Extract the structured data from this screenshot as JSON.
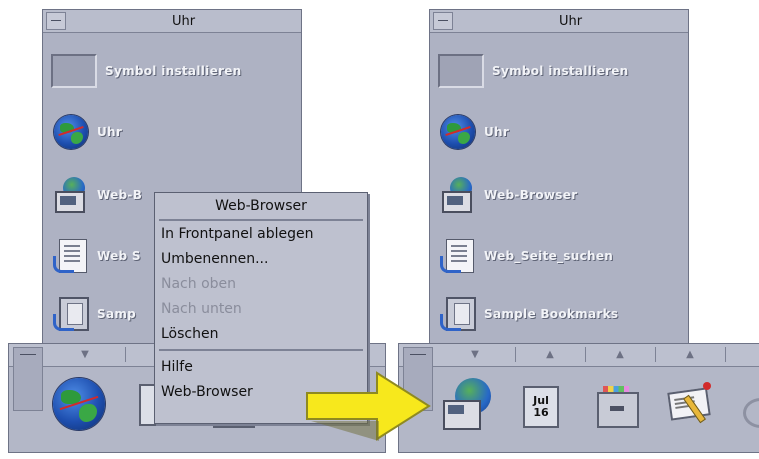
{
  "left_subpanel": {
    "title": "Uhr",
    "install_label": "Symbol installieren",
    "items": [
      {
        "label": "Uhr",
        "icon": "globe-icon"
      },
      {
        "label": "Web-B",
        "icon": "web-browser-icon"
      },
      {
        "label": "Web S",
        "icon": "web-page-search-icon"
      },
      {
        "label": "Samp",
        "icon": "sample-bookmarks-icon"
      }
    ]
  },
  "popup_menu": {
    "title": "Web-Browser",
    "items": [
      {
        "label": "In Frontpanel ablegen",
        "enabled": true
      },
      {
        "label": "Umbenennen...",
        "enabled": true
      },
      {
        "label": "Nach oben",
        "enabled": false
      },
      {
        "label": "Nach unten",
        "enabled": false
      },
      {
        "label": "Löschen",
        "enabled": true
      }
    ],
    "items_after_separator": [
      {
        "label": "Hilfe",
        "enabled": true
      },
      {
        "label": "Web-Browser",
        "enabled": true
      }
    ]
  },
  "right_subpanel": {
    "title": "Uhr",
    "install_label": "Symbol installieren",
    "items": [
      {
        "label": "Uhr",
        "icon": "globe-icon"
      },
      {
        "label": "Web-Browser",
        "icon": "web-browser-icon"
      },
      {
        "label": "Web_Seite_suchen",
        "icon": "web-page-search-icon"
      },
      {
        "label": "Sample Bookmarks",
        "icon": "sample-bookmarks-icon"
      }
    ]
  },
  "right_frontpanel": {
    "calendar_month": "Jul",
    "calendar_day": "16"
  },
  "colors": {
    "panel": "#aeb2c3",
    "arrow": "#f7e81c"
  }
}
